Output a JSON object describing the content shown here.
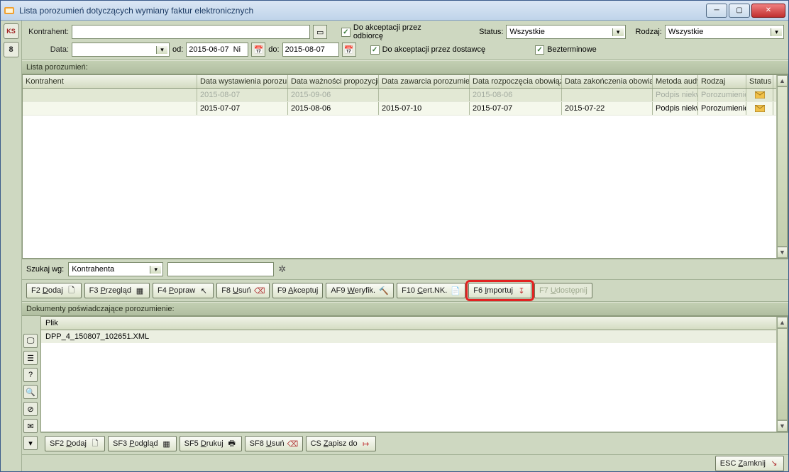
{
  "window": {
    "title": "Lista porozumień dotyczących wymiany faktur elektronicznych"
  },
  "filters": {
    "kontrahent_label": "Kontrahent:",
    "kontrahent_value": "",
    "data_label": "Data:",
    "data_value": "",
    "od_label": "od:",
    "od_value": "2015-06-07  Ni",
    "do_label": "do:",
    "do_value": "2015-08-07",
    "chk_odbiorca": "Do akceptacji przez odbiorcę",
    "chk_dostawca": "Do akceptacji przez dostawcę",
    "status_label": "Status:",
    "status_value": "Wszystkie",
    "rodzaj_label": "Rodzaj:",
    "rodzaj_value": "Wszystkie",
    "chk_bezterm": "Bezterminowe"
  },
  "sidebar_badge": "8",
  "list_header": "Lista porozumień:",
  "columns": {
    "c0": "Kontrahent",
    "c1": "Data wystawienia porozum",
    "c2": "Data ważności propozycji",
    "c3": "Data zawarcia porozumien",
    "c4": "Data rozpoczęcia obowiąz",
    "c5": "Data zakończenia obowią",
    "c6": "Metoda audy",
    "c7": "Rodzaj",
    "c8": "Status"
  },
  "rows": [
    {
      "kontrahent": "",
      "d_wyst": "2015-08-07",
      "d_wazn": "2015-09-06",
      "d_zaw": "",
      "d_rozp": "2015-08-06",
      "d_zak": "",
      "metoda": "Podpis niekw",
      "rodzaj": "Porozumienie"
    },
    {
      "kontrahent": "",
      "d_wyst": "2015-07-07",
      "d_wazn": "2015-08-06",
      "d_zaw": "2015-07-10",
      "d_rozp": "2015-07-07",
      "d_zak": "2015-07-22",
      "metoda": "Podpis niekw",
      "rodzaj": "Porozumienie"
    }
  ],
  "search": {
    "label": "Szukaj wg:",
    "field": "Kontrahenta",
    "text": ""
  },
  "toolbar_top": {
    "f2": "F2 Dodaj",
    "f3": "F3 Przegląd",
    "f4": "F4 Popraw",
    "f8": "F8 Usuń",
    "f9": "F9 Akceptuj",
    "af9": "AF9 Weryfik.",
    "f10": "F10 Cert.NK.",
    "f6": "F6 Importuj",
    "f7": "F7 Udostępnij"
  },
  "docs_header": "Dokumenty poświadczające porozumienie:",
  "docs_col": "Plik",
  "docs_row": "DPP_4_150807_102651.XML",
  "toolbar_bottom": {
    "sf2": "SF2 Dodaj",
    "sf3": "SF3 Podgląd",
    "sf5": "SF5 Drukuj",
    "sf8": "SF8 Usuń",
    "cs": "CS Zapisz do"
  },
  "footer_btn": "ESC Zamknij"
}
